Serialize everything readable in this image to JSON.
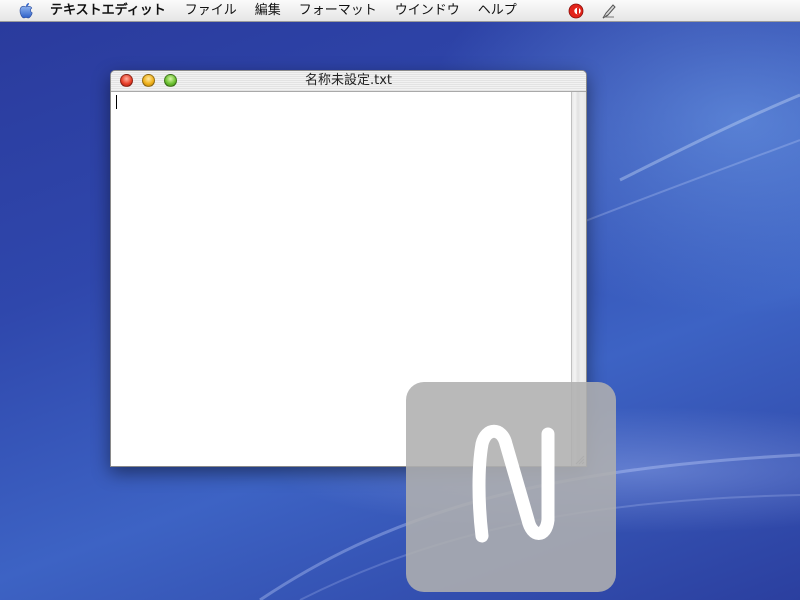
{
  "menubar": {
    "apple_icon": "apple-icon",
    "items": [
      "テキストエディット",
      "ファイル",
      "編集",
      "フォーマット",
      "ウインドウ",
      "ヘルプ"
    ],
    "extras": [
      "status-a-icon",
      "script-pen-icon"
    ]
  },
  "window": {
    "title": "名称未設定.txt",
    "body_text": ""
  },
  "hud": {
    "glyph": "N"
  },
  "colors": {
    "desktop": "#2f47ac",
    "accent_close": "#e8402a",
    "accent_minimize": "#f0b21c",
    "accent_zoom": "#6dc232"
  }
}
